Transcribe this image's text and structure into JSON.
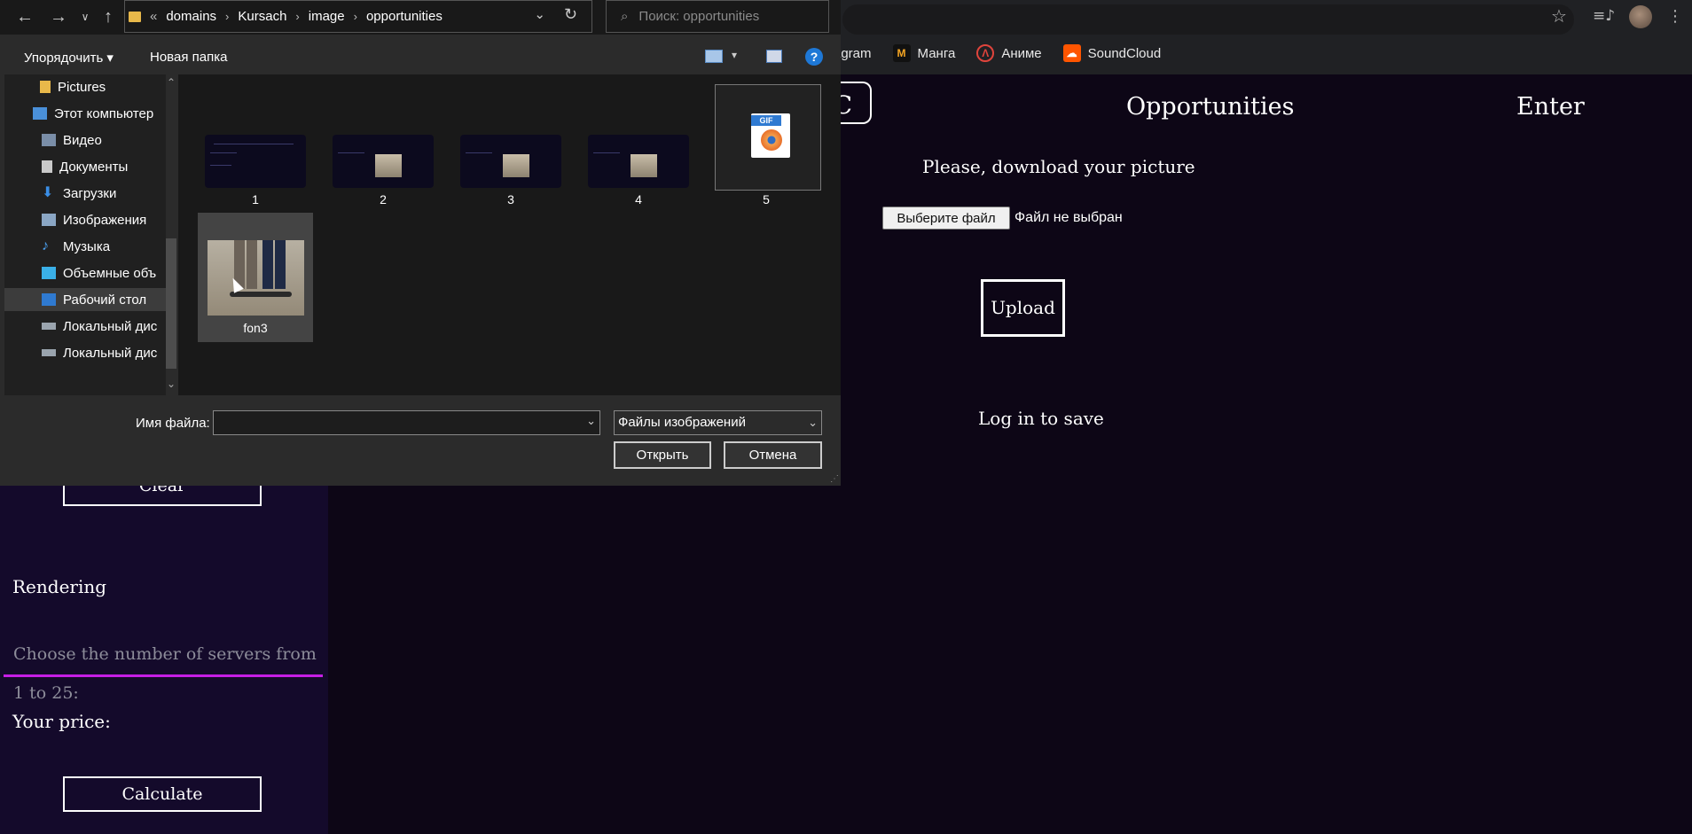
{
  "browser": {
    "bookmarks": [
      {
        "label": "agram",
        "icon": "instagram-icon"
      },
      {
        "label": "Манга",
        "icon": "manga-icon"
      },
      {
        "label": "Аниме",
        "icon": "anime-icon"
      },
      {
        "label": "SoundCloud",
        "icon": "soundcloud-icon"
      }
    ]
  },
  "site": {
    "logo_letter": "C",
    "nav": {
      "opportunities": "Opportunities",
      "enter": "Enter"
    },
    "main": {
      "download_prompt": "Please, download your picture",
      "choose_file": "Выберите файл",
      "no_file": "Файл не выбран",
      "upload": "Upload",
      "login_to_save": "Log in to save"
    },
    "sidebar": {
      "clear": "Clear",
      "rendering": "Rendering",
      "servers_placeholder": "Choose the number of servers from 1 to 25:",
      "price_label": "Your price:",
      "calculate": "Calculate"
    }
  },
  "dialog": {
    "breadcrumb": [
      "domains",
      "Kursach",
      "image",
      "opportunities"
    ],
    "breadcrumb_prefix": "«",
    "search_placeholder": "Поиск: opportunities",
    "toolbar": {
      "organize": "Упорядочить ▾",
      "new_folder": "Новая папка"
    },
    "nav_items": [
      {
        "label": "Pictures",
        "icon": "folder-icon"
      },
      {
        "label": "Этот компьютер",
        "icon": "computer-icon"
      },
      {
        "label": "Видео",
        "icon": "video-icon"
      },
      {
        "label": "Документы",
        "icon": "documents-icon"
      },
      {
        "label": "Загрузки",
        "icon": "downloads-icon"
      },
      {
        "label": "Изображения",
        "icon": "images-icon"
      },
      {
        "label": "Музыка",
        "icon": "music-icon"
      },
      {
        "label": "Объемные объ",
        "icon": "3d-objects-icon"
      },
      {
        "label": "Рабочий стол",
        "icon": "desktop-icon",
        "selected": true
      },
      {
        "label": "Локальный дис",
        "icon": "drive-icon"
      },
      {
        "label": "Локальный дис",
        "icon": "drive-icon"
      }
    ],
    "files": [
      {
        "name": "1"
      },
      {
        "name": "2"
      },
      {
        "name": "3"
      },
      {
        "name": "4"
      },
      {
        "name": "5",
        "kind": "gif",
        "badge": "GIF"
      },
      {
        "name": "fon3",
        "selected": true
      }
    ],
    "filename_label": "Имя файла:",
    "filename_value": "",
    "filetype": "Файлы изображений",
    "open": "Открыть",
    "cancel": "Отмена"
  }
}
